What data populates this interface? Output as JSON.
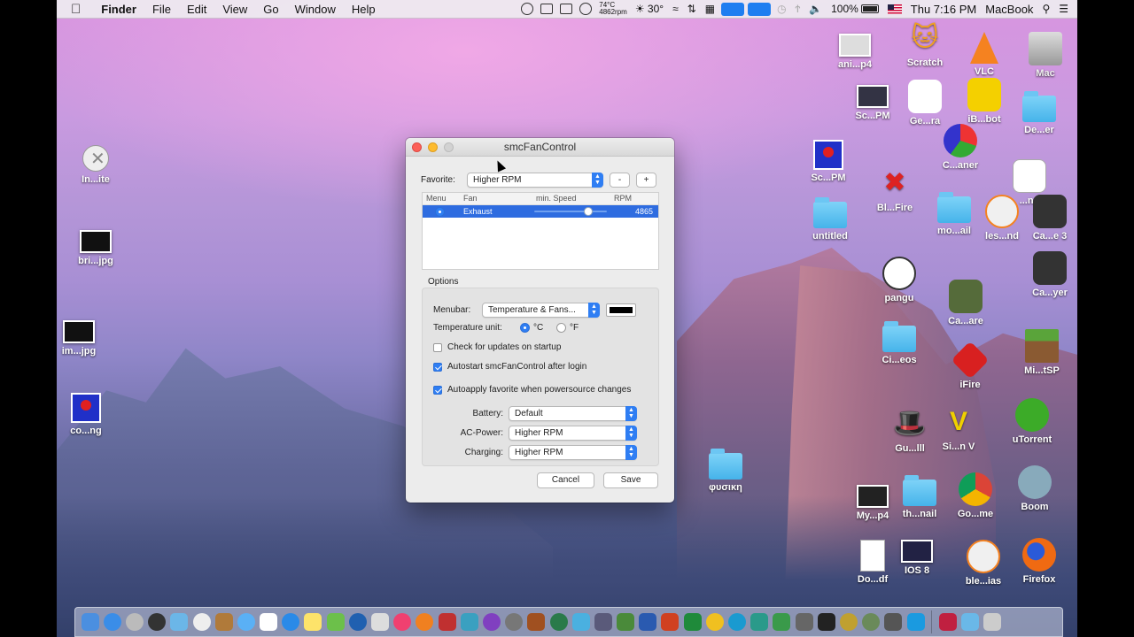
{
  "menubar": {
    "app_name": "Finder",
    "menus": [
      "File",
      "Edit",
      "View",
      "Go",
      "Window",
      "Help"
    ],
    "fan_temp": "74°C",
    "fan_rpm": "4862rpm",
    "weather": "30°",
    "battery": "100%",
    "clock": "Thu 7:16 PM",
    "computer_name": "MacBook"
  },
  "desktop_left": [
    {
      "label": "In...ite"
    },
    {
      "label": "bri...jpg"
    },
    {
      "label": "im...jpg"
    },
    {
      "label": "co...ng"
    }
  ],
  "desktop_right": [
    {
      "label": "ani...p4"
    },
    {
      "label": "Scratch"
    },
    {
      "label": "VLC"
    },
    {
      "label": "Mac"
    },
    {
      "label": "Sc...PM"
    },
    {
      "label": "Ge...ra"
    },
    {
      "label": "iB...bot"
    },
    {
      "label": "De...er"
    },
    {
      "label": "Sc...PM"
    },
    {
      "label": "C...aner"
    },
    {
      "label": "Bl...Fire"
    },
    {
      "label": "...ng"
    },
    {
      "label": "untitled"
    },
    {
      "label": "mo...ail"
    },
    {
      "label": "les...nd"
    },
    {
      "label": "Ca...e 3"
    },
    {
      "label": "pangu"
    },
    {
      "label": "Ca...yer"
    },
    {
      "label": "Ca...are"
    },
    {
      "label": "Ci...eos"
    },
    {
      "label": "iFire"
    },
    {
      "label": "Mi...tSP"
    },
    {
      "label": "Gu...lll"
    },
    {
      "label": "Si...n V"
    },
    {
      "label": "uTorrent"
    },
    {
      "label": "φυσικη"
    },
    {
      "label": "My...p4"
    },
    {
      "label": "th...nail"
    },
    {
      "label": "Go...me"
    },
    {
      "label": "Boom"
    },
    {
      "label": "Do...df"
    },
    {
      "label": "IOS 8"
    },
    {
      "label": "ble...ias"
    },
    {
      "label": "Firefox"
    }
  ],
  "window": {
    "title": "smcFanControl",
    "favorite_label": "Favorite:",
    "favorite_value": "Higher RPM",
    "minus_label": "-",
    "plus_label": "+",
    "table_headers": [
      "Menu",
      "Fan",
      "min. Speed",
      "RPM"
    ],
    "fan_name": "Exhaust",
    "fan_rpm": "4865",
    "fan_speed_fraction": 0.78,
    "options_title": "Options",
    "menubar_label": "Menubar:",
    "menubar_value": "Temperature & Fans...",
    "temp_unit_label": "Temperature unit:",
    "unit_c": "°C",
    "unit_f": "°F",
    "check_updates": "Check for updates on startup",
    "autostart": "Autostart smcFanControl after login",
    "autoapply": "Autoapply favorite when powersource changes",
    "battery_label": "Battery:",
    "battery_value": "Default",
    "ac_label": "AC-Power:",
    "ac_value": "Higher RPM",
    "charging_label": "Charging:",
    "charging_value": "Higher RPM",
    "cancel_label": "Cancel",
    "save_label": "Save"
  }
}
